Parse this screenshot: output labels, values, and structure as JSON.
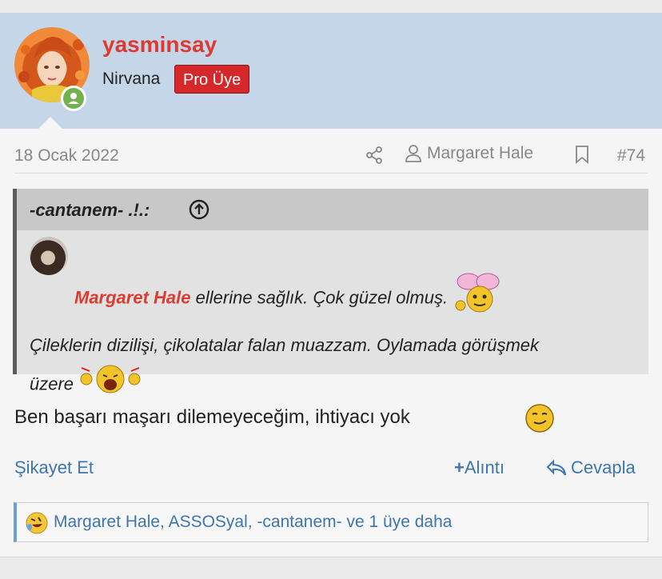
{
  "user": {
    "username": "yasminsay",
    "title": "Nirvana",
    "banner": "Pro Üye"
  },
  "meta": {
    "date": "18 Ocak 2022",
    "author": "Margaret Hale",
    "post_number": "#74"
  },
  "quote": {
    "author": "-cantanem- .!.:",
    "mention": "Margaret Hale",
    "text_line1": " ellerine sağlık. Çok güzel olmuş.",
    "text_line2": "Çileklerin dizilişi, çikolatalar falan muazzam. Oylamada görüşmek",
    "text_line3": "üzere "
  },
  "message": {
    "text": "Ben başarı maşarı dilemeyeceğim, ihtiyacı yok"
  },
  "actions": {
    "report": "Şikayet Et",
    "quote": "Alıntı",
    "reply": "Cevapla"
  },
  "reactions": {
    "text": "Margaret Hale, ASSOSyal, -cantanem- ve 1 üye daha"
  },
  "colors": {
    "header_bg": "#c5d6e8",
    "username": "#de3b30",
    "banner_bg": "#d4282b",
    "link": "#3d76b0",
    "online": "#74b04e"
  }
}
